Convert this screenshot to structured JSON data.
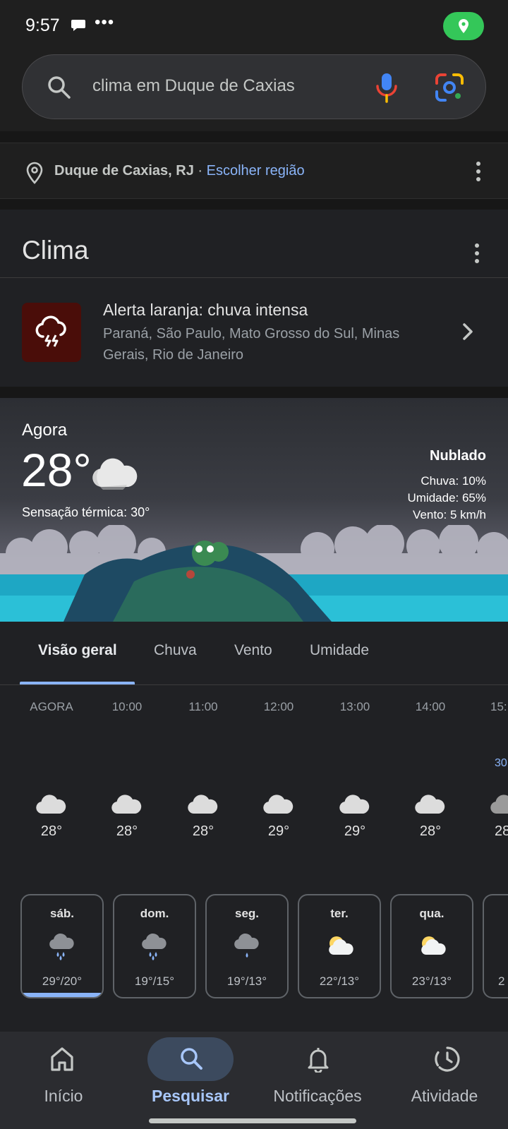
{
  "status_bar": {
    "time": "9:57",
    "dots": "•••"
  },
  "search": {
    "query": "clima em Duque de Caxias"
  },
  "location": {
    "name": "Duque de Caxias, RJ",
    "separator": " · ",
    "link": "Escolher região"
  },
  "card": {
    "title": "Clima",
    "alert": {
      "title": "Alerta laranja: chuva intensa",
      "regions": "Paraná, São Paulo, Mato Grosso do Sul, Minas Gerais, Rio de Janeiro"
    },
    "now": {
      "label": "Agora",
      "temp": "28°",
      "feels_like": "Sensação térmica: 30°",
      "condition": "Nublado",
      "rain": "Chuva: 10%",
      "humidity": "Umidade: 65%",
      "wind": "Vento: 5 km/h"
    },
    "tabs": [
      "Visão geral",
      "Chuva",
      "Vento",
      "Umidade"
    ],
    "hourly": [
      {
        "time": "AGORA",
        "temp": "28°"
      },
      {
        "time": "10:00",
        "temp": "28°"
      },
      {
        "time": "11:00",
        "temp": "28°"
      },
      {
        "time": "12:00",
        "temp": "29°"
      },
      {
        "time": "13:00",
        "temp": "29°"
      },
      {
        "time": "14:00",
        "temp": "28°"
      },
      {
        "time": "15:",
        "temp": "28",
        "extra": "30"
      }
    ],
    "daily": [
      {
        "day": "sáb.",
        "temps": "29°/20°",
        "icon": "rain-cloud-icon"
      },
      {
        "day": "dom.",
        "temps": "19°/15°",
        "icon": "rain-cloud-icon"
      },
      {
        "day": "seg.",
        "temps": "19°/13°",
        "icon": "drizzle-cloud-icon"
      },
      {
        "day": "ter.",
        "temps": "22°/13°",
        "icon": "partly-cloudy-icon"
      },
      {
        "day": "qua.",
        "temps": "23°/13°",
        "icon": "partly-cloudy-icon"
      },
      {
        "day": "",
        "temps": "2"
      }
    ]
  },
  "nav": [
    {
      "label": "Início",
      "icon": "home-icon"
    },
    {
      "label": "Pesquisar",
      "icon": "search-icon"
    },
    {
      "label": "Notificações",
      "icon": "bell-icon"
    },
    {
      "label": "Atividade",
      "icon": "activity-icon"
    }
  ],
  "colors": {
    "accent": "#8ab4f8",
    "alert_bg": "#4a0d09",
    "location_pill": "#34c759"
  }
}
